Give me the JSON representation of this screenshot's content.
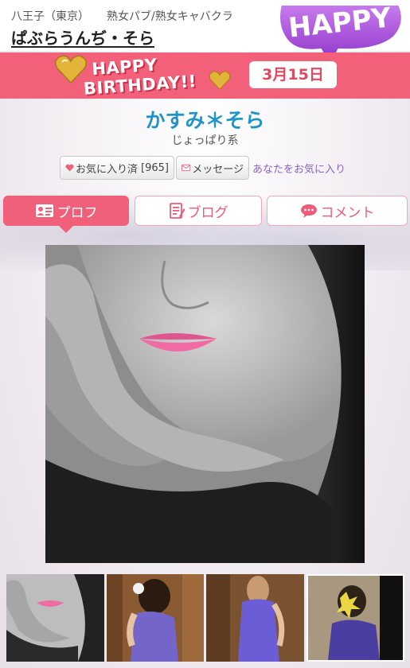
{
  "header": {
    "area": "八王子（東京）",
    "category": "熟女パブ/熟女キャバクラ",
    "shop_name": "ぱぶらうんぢ・そら",
    "badge": "HAPPY"
  },
  "birthday": {
    "line1": "HAPPY",
    "line2": "BIRTHDAY!!",
    "date": "3月15日"
  },
  "profile": {
    "name": "かすみ＊そら",
    "type": "じょっぱり系"
  },
  "actions": {
    "favorite_label": "お気に入り済",
    "favorite_count": "[965]",
    "message_label": "メッセージ",
    "favorite_link": "あなたをお気に入り"
  },
  "tabs": [
    {
      "label": "プロフ",
      "active": true
    },
    {
      "label": "ブログ",
      "active": false
    },
    {
      "label": "コメント",
      "active": false
    }
  ],
  "colors": {
    "accent_pink": "#f0607b",
    "name_blue": "#1f94c8",
    "link_purple": "#8a60c4",
    "badge_purple": "#a54ad8"
  },
  "icons": [
    "heart-icon",
    "envelope-icon",
    "profile-card-icon",
    "memo-icon",
    "speech-bubble-icon"
  ]
}
